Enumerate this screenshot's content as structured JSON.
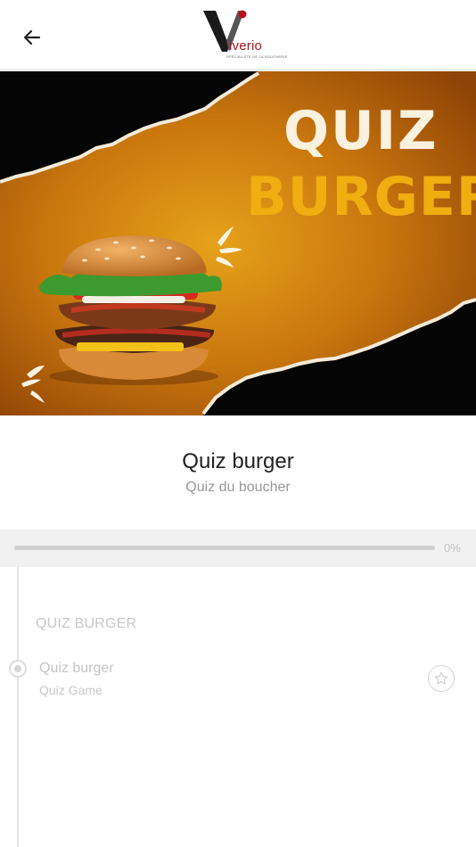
{
  "header": {
    "back_icon": "arrow-left-icon",
    "logo_word": "iverio",
    "logo_tagline": "SPÉCIALISTE DE LA BOUCHERIE"
  },
  "hero": {
    "title_line1": "QUIZ",
    "title_line2": "BURGER",
    "colors": {
      "background": "#c06d0c",
      "title_line1": "#fbf1df",
      "title_line2": "#f0ae11"
    }
  },
  "course": {
    "title": "Quiz burger",
    "subtitle": "Quiz du boucher"
  },
  "progress": {
    "value": 0,
    "label": "0%"
  },
  "section": {
    "title": "QUIZ BURGER",
    "items": [
      {
        "title": "Quiz burger",
        "subtitle": "Quiz Game",
        "favorite_icon": "star-icon"
      }
    ]
  },
  "colors": {
    "brand": "#b5121b",
    "accent": "#e06b1f"
  }
}
